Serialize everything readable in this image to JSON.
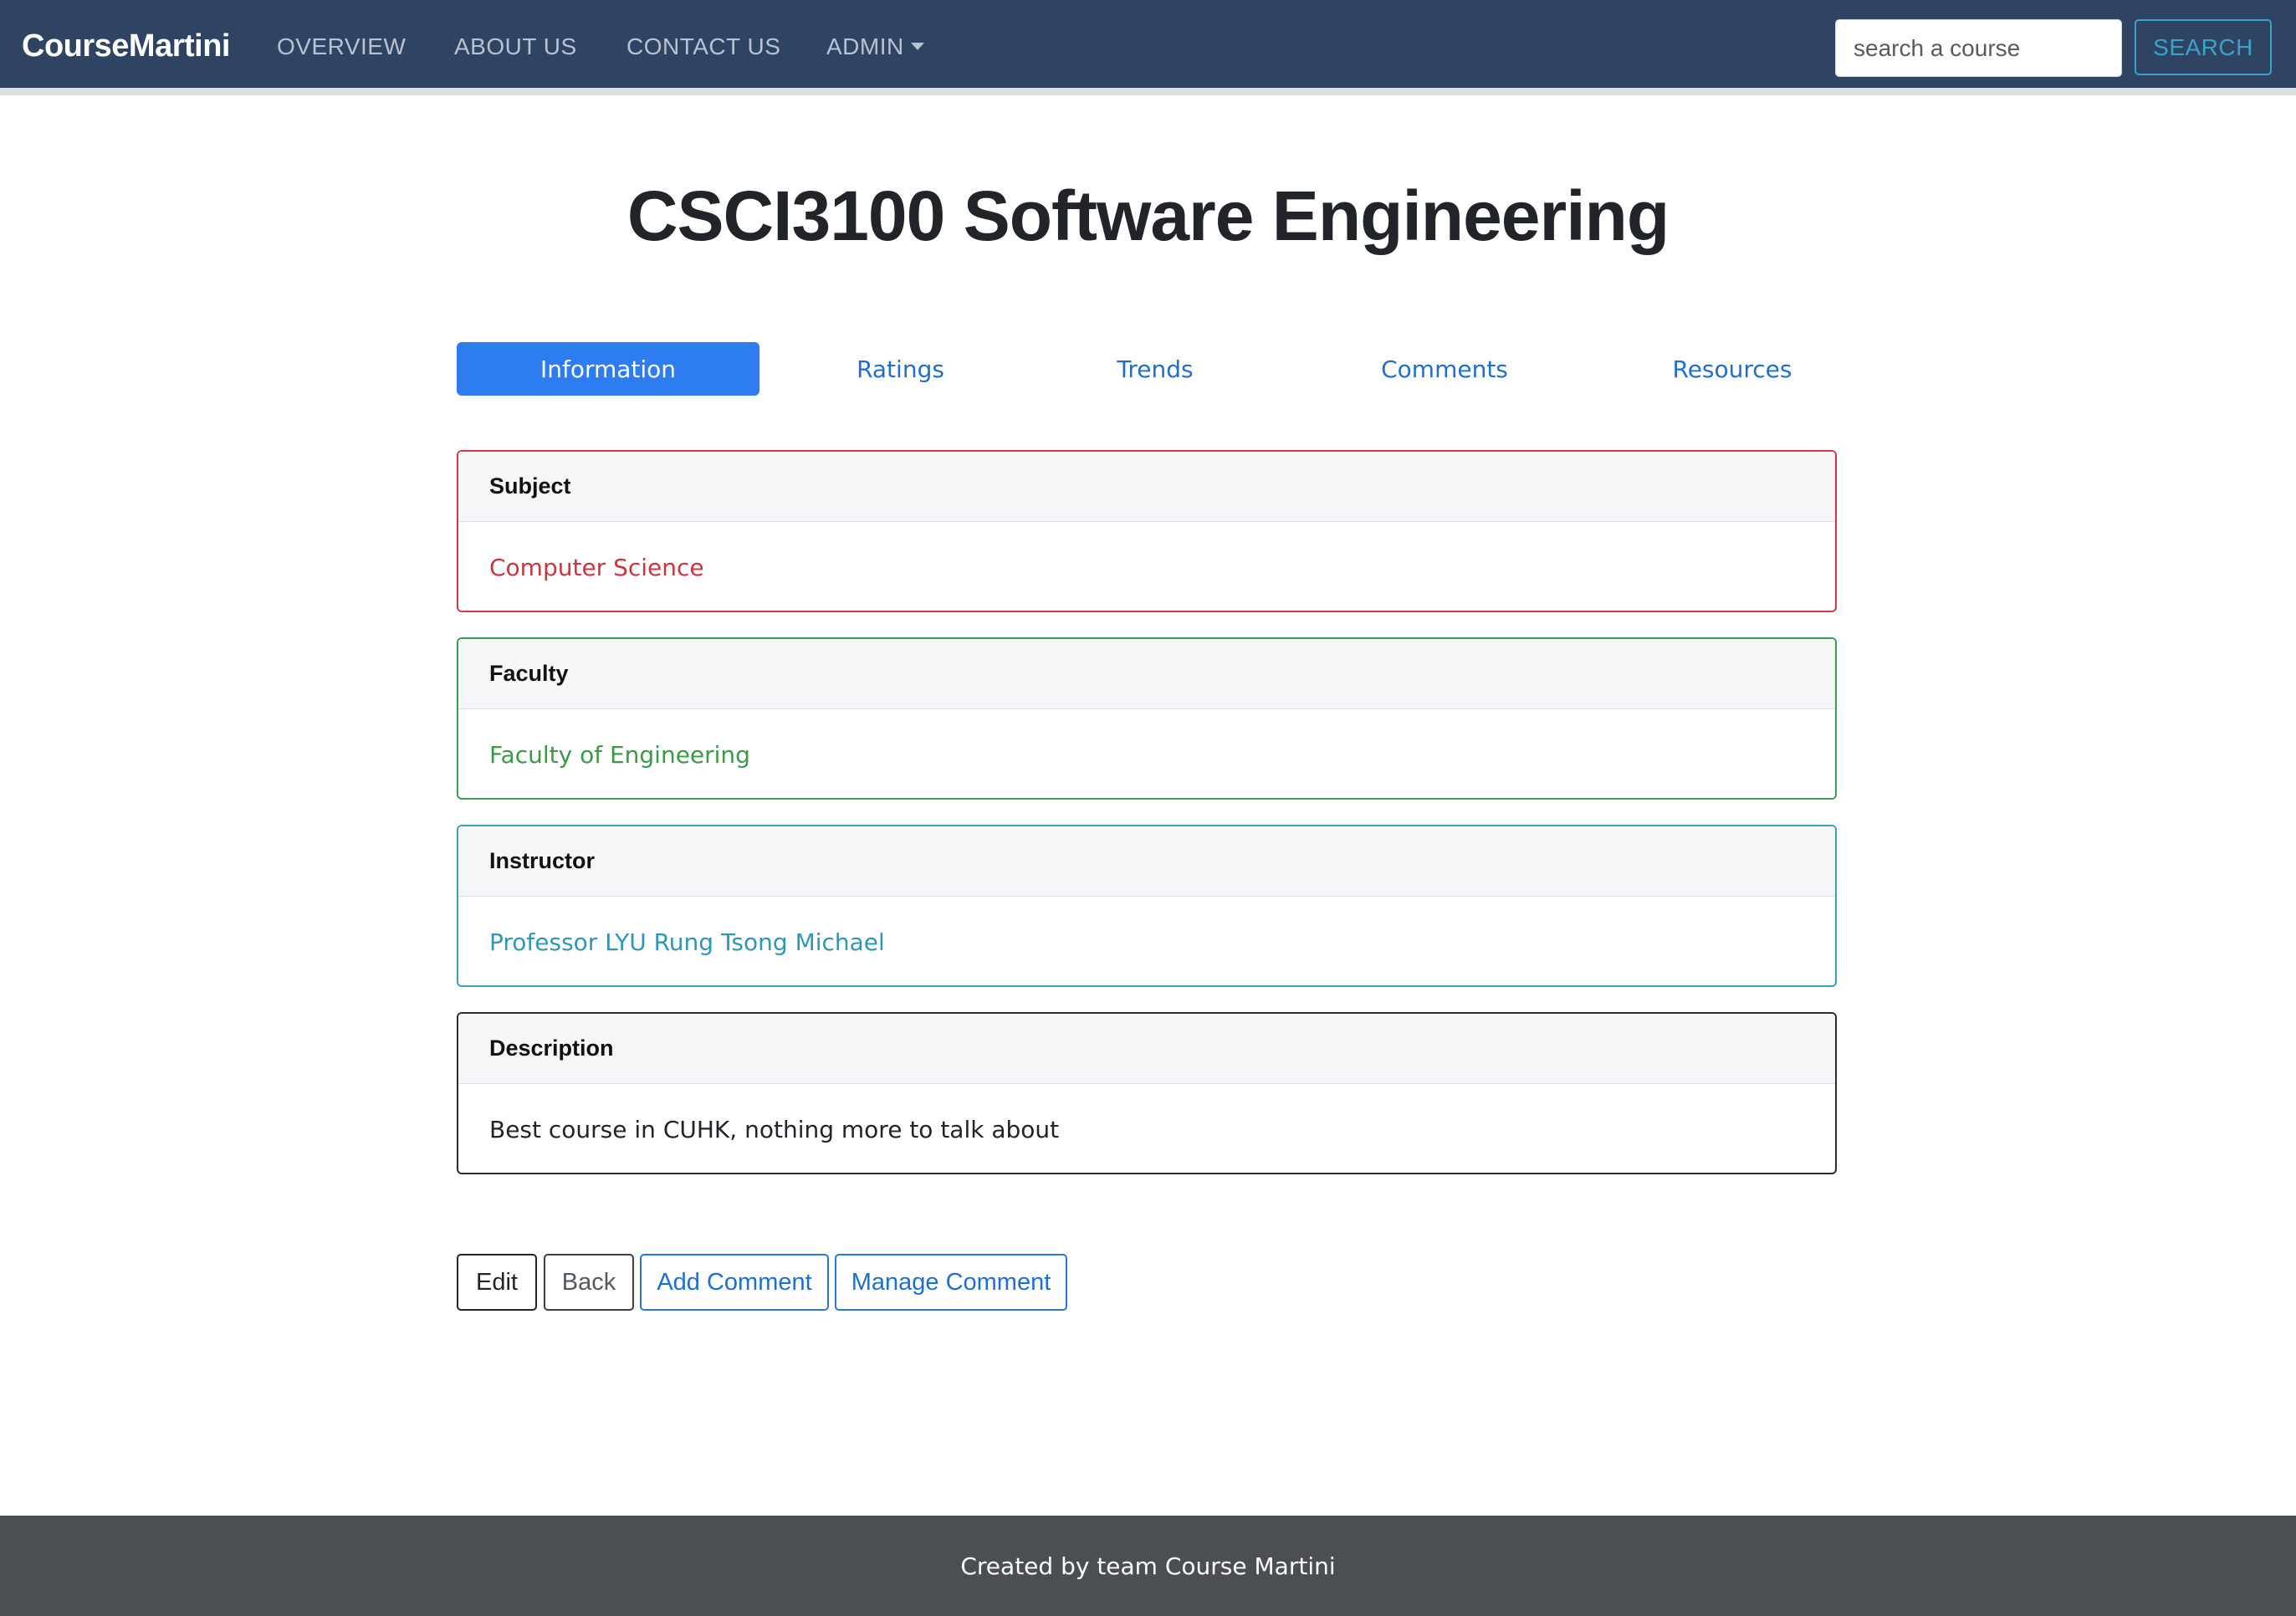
{
  "navbar": {
    "brand": "CourseMartini",
    "links": {
      "overview": "OVERVIEW",
      "about": "ABOUT US",
      "contact": "CONTACT US",
      "admin": "ADMIN"
    },
    "search": {
      "placeholder": "search a course",
      "value": "",
      "button_label": "SEARCH"
    },
    "background_color": "#2f4463"
  },
  "page": {
    "title": "CSCI3100 Software Engineering"
  },
  "tabs": {
    "items": [
      {
        "label": "Information",
        "active": true
      },
      {
        "label": "Ratings",
        "active": false
      },
      {
        "label": "Trends",
        "active": false
      },
      {
        "label": "Comments",
        "active": false
      },
      {
        "label": "Resources",
        "active": false
      }
    ],
    "active_color": "#2d7cf0"
  },
  "cards": {
    "subject": {
      "header": "Subject",
      "value": "Computer Science",
      "color": "#cf3c49"
    },
    "faculty": {
      "header": "Faculty",
      "value": "Faculty of Engineering",
      "color": "#3e9d4e"
    },
    "instructor": {
      "header": "Instructor",
      "value": "Professor LYU Rung Tsong Michael",
      "color": "#3aa0bd"
    },
    "description": {
      "header": "Description",
      "value": "Best course in CUHK, nothing more to talk about",
      "color": "#2a2d30"
    }
  },
  "actions": {
    "edit": "Edit",
    "back": "Back",
    "add_comment": "Add Comment",
    "manage_comment": "Manage Comment"
  },
  "footer": {
    "text": "Created by team Course Martini"
  }
}
